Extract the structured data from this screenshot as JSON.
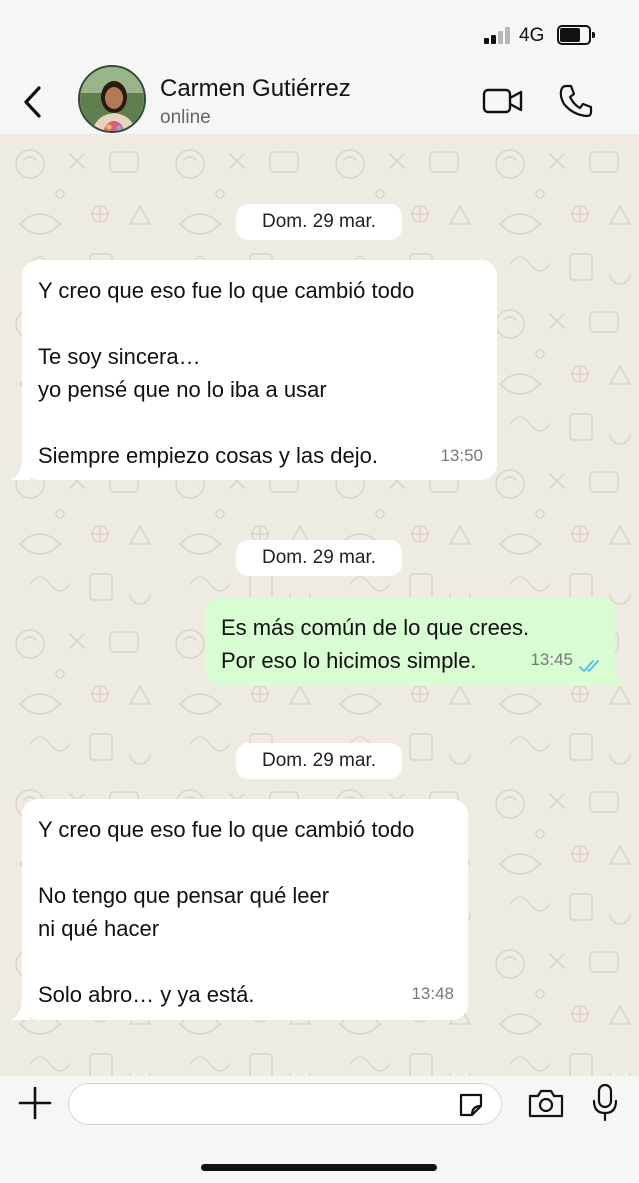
{
  "status_bar": {
    "network": "4G",
    "signal_bars": 2,
    "signal_bars_total": 4
  },
  "header": {
    "contact_name": "Carmen Gutiérrez",
    "contact_status": "online"
  },
  "messages": [
    {
      "type": "date",
      "text": "Dom. 29 mar."
    },
    {
      "type": "incoming",
      "lines": [
        "Y creo que eso fue lo que cambió todo",
        "",
        "Te soy sincera…",
        "yo pensé que no lo iba a usar",
        "",
        "Siempre empiezo cosas y las dejo."
      ],
      "time": "13:50"
    },
    {
      "type": "date",
      "text": "Dom. 29 mar."
    },
    {
      "type": "outgoing",
      "lines": [
        "Es más común de lo que crees.",
        "Por eso lo hicimos simple."
      ],
      "time": "13:45",
      "read": true
    },
    {
      "type": "date",
      "text": "Dom. 29 mar."
    },
    {
      "type": "incoming",
      "lines": [
        "Y creo que eso fue lo que cambió todo",
        "",
        "No tengo que pensar qué leer",
        "ni qué hacer",
        "",
        "Solo abro… y ya está."
      ],
      "time": "13:48"
    }
  ],
  "input": {
    "value": "",
    "placeholder": ""
  },
  "colors": {
    "chat_background": "#efeae2",
    "incoming_bubble": "#ffffff",
    "outgoing_bubble": "#d9fdd3",
    "read_ticks": "#53bdeb",
    "bar_background": "#f6f6f6"
  }
}
